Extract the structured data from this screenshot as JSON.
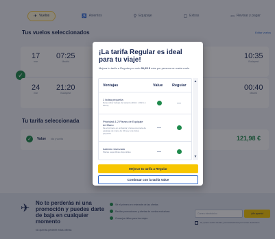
{
  "tabs": [
    {
      "label": "Vuelos",
      "icon": "plane-icon"
    },
    {
      "label": "Asientos",
      "icon": "seat-icon"
    },
    {
      "label": "Equipaje",
      "icon": "bag-icon"
    },
    {
      "label": "Extras",
      "icon": "extras-icon"
    },
    {
      "label": "Revisar y pagar",
      "icon": "card-icon"
    }
  ],
  "background": {
    "flights_title": "Tus vuelos seleccionados",
    "flights_link": "Editar vuelos",
    "outbound": {
      "day": "17",
      "day_label": "mar",
      "dep_time": "07:25",
      "dep_city": "Madrid",
      "arr_time": "10:35",
      "arr_city": "Budapest"
    },
    "return": {
      "day": "24",
      "day_label": "mar",
      "dep_time": "21:20",
      "dep_city": "Budapest",
      "arr_time": "00:40",
      "arr_city": "Madrid"
    },
    "fare_title": "Tu tarifa seleccionada",
    "fare_name": "Value",
    "fare_sub": "Ida y vuelta",
    "fare_price": "121,98 €"
  },
  "promo": {
    "title": "No te perderás ni una promoción y puedes darte de baja en cualquier momento",
    "subtitle": "No querrás perderte estas ofertas",
    "points": [
      "Sé el primero en enterarte de las ofertas",
      "Recibe promociones y ofertas de vuelos exclusivas",
      "Consejos útiles para tus viajes"
    ],
    "email_placeholder": "Correo electrónico",
    "subscribe_label": "¡Me apunto!",
    "consent_text": "Sí, quiero recibir ofertas y comunicaciones por correo electrónico"
  },
  "modal": {
    "title": "¡La tarifa Regular es ideal para tu viaje!",
    "desc_prefix": "Mejora tu tarifa a Regular por solo ",
    "desc_amount": "31,25 €",
    "desc_suffix": " más por persona en cada vuelo",
    "table": {
      "headers": [
        "Ventajas",
        "Value",
        "Regular"
      ],
      "rows": [
        {
          "title": "1 bolsa pequeña",
          "desc": "Debe caber debajo del asiento (40cm x 30cm x 20cm)",
          "value": "check",
          "regular": "dash"
        },
        {
          "title": "Prioridad & 2 Piezas de Equipaje de Mano",
          "desc": "Sé el primero en embarcar y lleva una pieza de equipaje de mano de 10 kg y una bolsa pequeña",
          "value": "dash",
          "regular": "check"
        },
        {
          "title": "Asiento reservado",
          "desc": "Plazas específicas disponibles",
          "value": "dash",
          "regular": "check"
        }
      ]
    },
    "primary_button": "Mejorar tu tarifa a Regular",
    "secondary_button": "Continuar con la tarifa Value"
  },
  "colors": {
    "brand_navy": "#1b2a55",
    "accent_yellow": "#f7c600",
    "success_green": "#1f8a4c",
    "link_blue": "#2c65c9"
  }
}
